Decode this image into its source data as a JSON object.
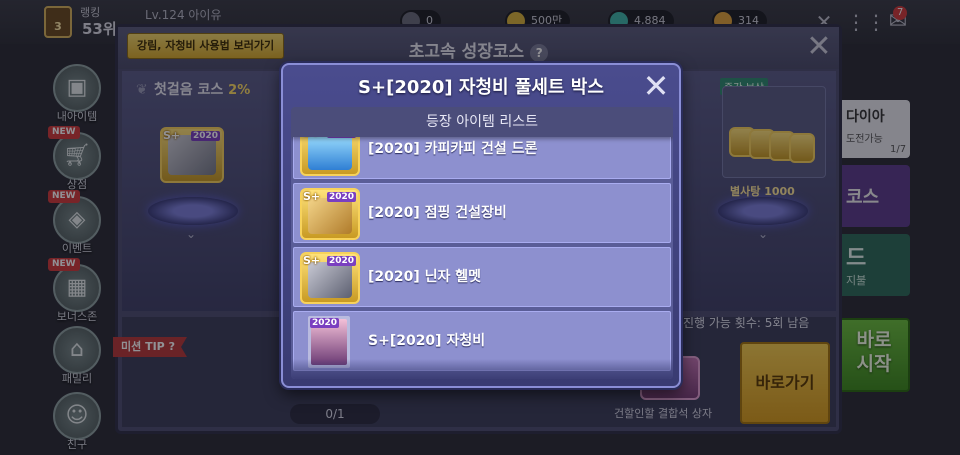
{
  "top_bar": {
    "rank_number": "3",
    "rank_label": "랭킹",
    "rank_value": "53위",
    "level": "Lv.124 아이유",
    "currencies": [
      "0",
      "500만",
      "4,884",
      "314"
    ],
    "mail_count": "7"
  },
  "side_menu": [
    {
      "label": "내아이템",
      "icon": "bag-icon",
      "new": false
    },
    {
      "label": "상점",
      "icon": "cart-icon",
      "new": true
    },
    {
      "label": "이벤트",
      "icon": "event-icon",
      "new": true
    },
    {
      "label": "보너스존",
      "icon": "gift-icon",
      "new": true
    },
    {
      "label": "패밀리",
      "icon": "house-icon",
      "new": false
    },
    {
      "label": "친구",
      "icon": "friend-icon",
      "new": false
    }
  ],
  "new_tag": "NEW",
  "panel": {
    "guide_button": "강림, 자청비 사용법 보러가기",
    "title": "초고속 성장코스",
    "help": "?",
    "course_name": "첫걸음 코스",
    "course_pct": "2%",
    "reward_tag": "중간 보상",
    "reward_label": "별사탕 1000",
    "mission_tip": "미션 TIP",
    "progress": "0/1",
    "remaining": "진행 가능 횟수: 5회 남음",
    "chest_label": "건할인할 결합석 상자",
    "go_button": "바로가기"
  },
  "right_tiles": {
    "diamond_title": "다이아",
    "diamond_sub": "도전가능",
    "diamond_count": "1/7",
    "course": "코스",
    "card": "드",
    "card_sub": "지불",
    "start": "바로\n시작"
  },
  "modal": {
    "title": "S+[2020] 자청비 풀세트 박스",
    "list_header": "등장 아이템 리스트",
    "items": [
      {
        "name": "[2020] 카피카피 건설 드론",
        "thumb": "drone-icon"
      },
      {
        "name": "[2020] 점핑 건설장비",
        "thumb": "equipment-icon"
      },
      {
        "name": "[2020] 닌자 헬멧",
        "thumb": "helmet-icon"
      },
      {
        "name": "S+[2020] 자청비",
        "thumb": "character-portrait"
      }
    ],
    "badge_splus": "S+",
    "badge_year": "2020"
  },
  "colors": {
    "modal_bg": "#4a4c8e",
    "item_bg": "#8d90cf",
    "gold": "#f7d25b",
    "year_tag": "#7a3fc0",
    "mission_red": "#b93838",
    "go_yellow": "#f6cc4c",
    "start_green": "#6bbf3c"
  }
}
